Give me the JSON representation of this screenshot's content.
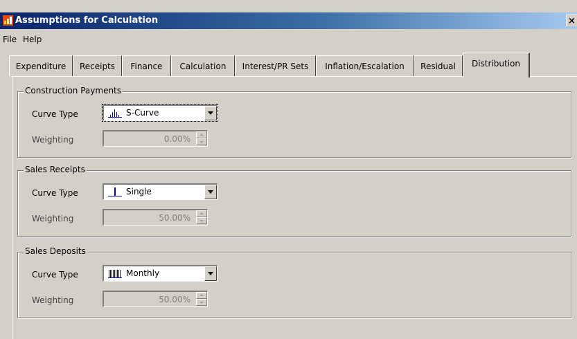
{
  "window": {
    "title": "Assumptions for Calculation",
    "close_label": "×"
  },
  "menu": [
    {
      "label": "File"
    },
    {
      "label": "Help"
    }
  ],
  "tabs": [
    {
      "label": "Expenditure"
    },
    {
      "label": "Receipts"
    },
    {
      "label": "Finance"
    },
    {
      "label": "Calculation"
    },
    {
      "label": "Interest/PR Sets"
    },
    {
      "label": "Inflation/Escalation"
    },
    {
      "label": "Residual"
    },
    {
      "label": "Distribution",
      "active": true
    }
  ],
  "groups": [
    {
      "title": "Construction Payments",
      "curve_label": "Curve Type",
      "curve_value": "S-Curve",
      "curve_icon": "s-curve-icon",
      "weight_label": "Weighting",
      "weight_value": "0.00%"
    },
    {
      "title": "Sales Receipts",
      "curve_label": "Curve Type",
      "curve_value": "Single",
      "curve_icon": "single-icon",
      "weight_label": "Weighting",
      "weight_value": "50.00%"
    },
    {
      "title": "Sales Deposits",
      "curve_label": "Curve Type",
      "curve_value": "Monthly",
      "curve_icon": "monthly-icon",
      "weight_label": "Weighting",
      "weight_value": "50.00%"
    }
  ]
}
